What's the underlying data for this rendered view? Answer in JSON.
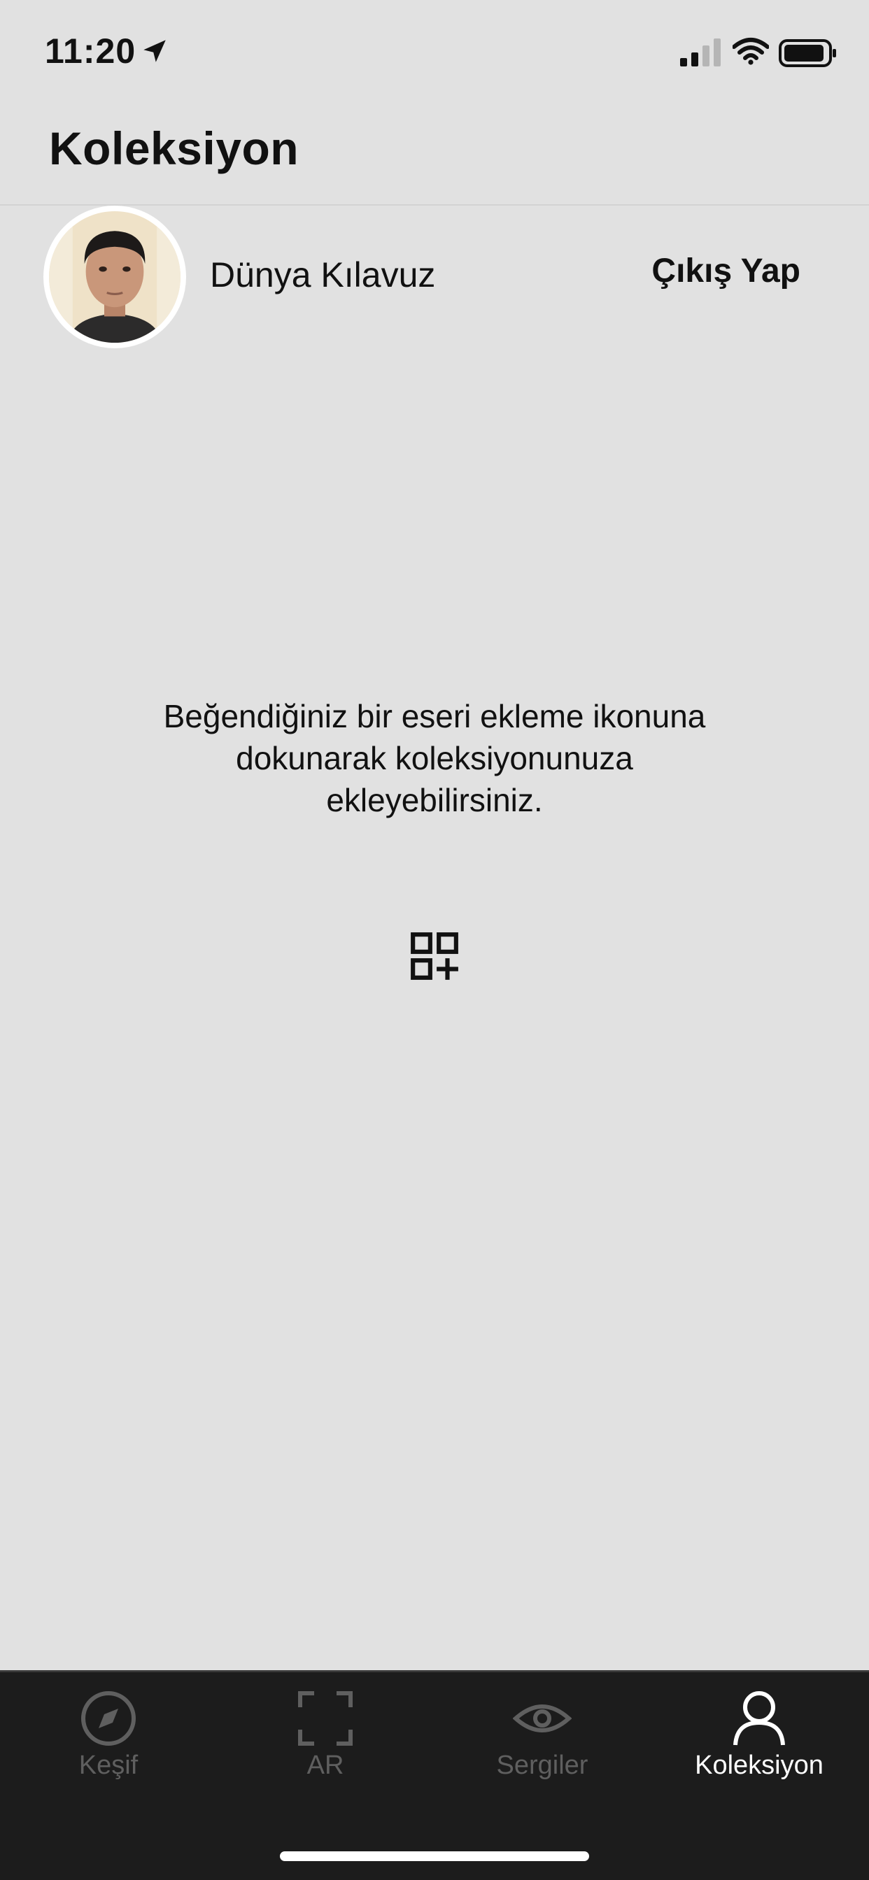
{
  "status_bar": {
    "time": "11:20",
    "icons": [
      "location-arrow-icon",
      "cellular-signal-icon",
      "wifi-icon",
      "battery-icon"
    ]
  },
  "header": {
    "title": "Koleksiyon"
  },
  "profile": {
    "name": "Dünya Kılavuz",
    "logout_label": "Çıkış Yap",
    "avatar_icon": "user-photo"
  },
  "empty_state": {
    "message": "Beğendiğiniz bir eseri ekleme ikonuna dokunarak koleksiyonunuza ekleyebilirsiniz.",
    "icon": "add-to-collection-icon"
  },
  "tab_bar": {
    "tabs": [
      {
        "label": "Keşif",
        "icon": "compass-icon",
        "active": false
      },
      {
        "label": "AR",
        "icon": "ar-frame-icon",
        "active": false
      },
      {
        "label": "Sergiler",
        "icon": "eye-icon",
        "active": false
      },
      {
        "label": "Koleksiyon",
        "icon": "person-icon",
        "active": true
      }
    ]
  },
  "colors": {
    "background": "#e1e1e1",
    "tab_bar_background": "#1c1c1c",
    "tab_active": "#ffffff",
    "tab_inactive": "#5f5f5f"
  }
}
